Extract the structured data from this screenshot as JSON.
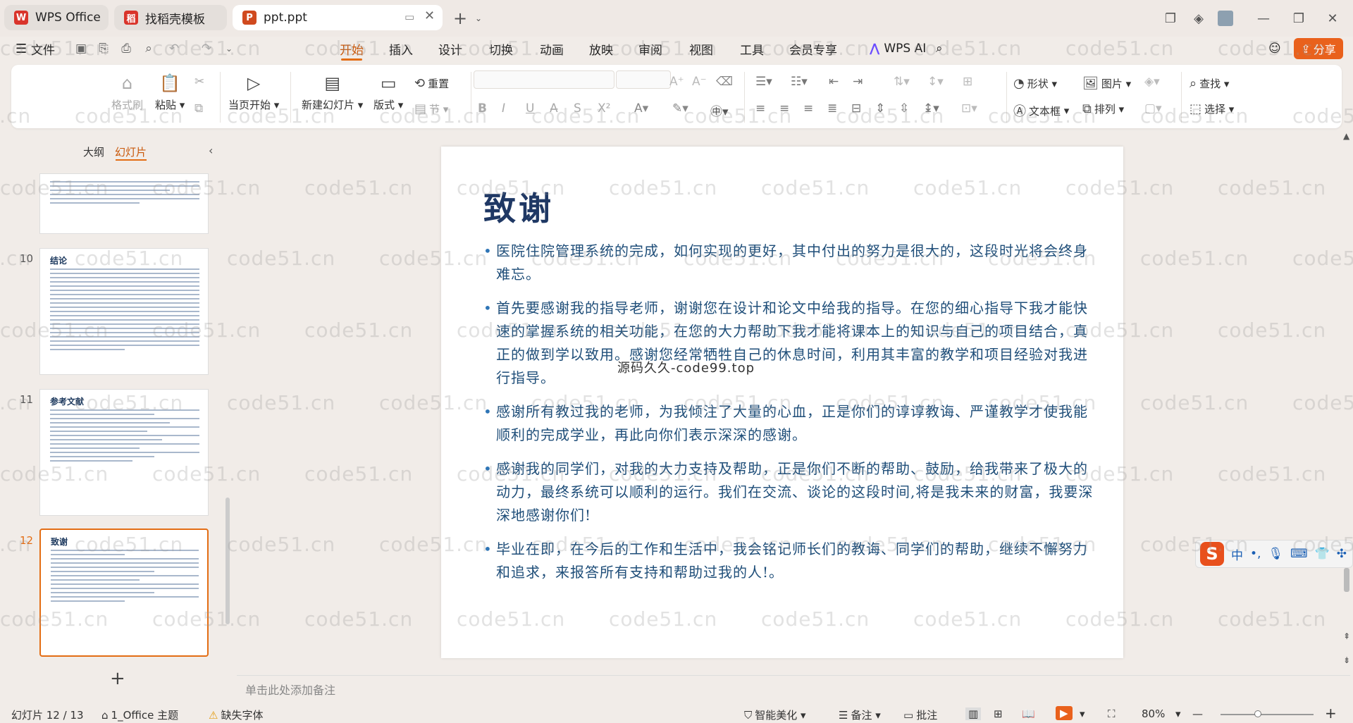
{
  "titlebar": {
    "tabs": [
      {
        "label": "WPS Office",
        "logo": "W",
        "color": "#d9342b"
      },
      {
        "label": "找稻壳模板",
        "logo": "稻",
        "color": "#d9342b"
      },
      {
        "label": "ppt.ppt",
        "logo": "P",
        "color": "#d04a1f"
      }
    ],
    "new_tab_icon": "+"
  },
  "menu": {
    "file": "文件",
    "items": [
      "开始",
      "插入",
      "设计",
      "切换",
      "动画",
      "放映",
      "审阅",
      "视图",
      "工具",
      "会员专享"
    ],
    "wps_ai": "WPS AI",
    "share": "分享",
    "active": "开始"
  },
  "ribbon": {
    "format_painter": "格式刷",
    "paste": "粘贴",
    "play_current": "当页开始",
    "new_slide": "新建幻灯片",
    "layout": "版式",
    "reset": "重置",
    "section": "节",
    "shape": "形状",
    "picture": "图片",
    "textbox": "文本框",
    "arrange": "排列",
    "find": "查找",
    "select": "选择"
  },
  "panel": {
    "outline_tab": "大纲",
    "slides_tab": "幻灯片",
    "add_icon": "+",
    "slides": [
      {
        "num": "10",
        "title": "结论"
      },
      {
        "num": "11",
        "title": "参考文献"
      },
      {
        "num": "12",
        "title": "致谢"
      }
    ]
  },
  "slide": {
    "title": "致谢",
    "bullets": [
      "医院住院管理系统的完成，如何实现的更好，其中付出的努力是很大的，这段时光将会终身难忘。",
      "首先要感谢我的指导老师，谢谢您在设计和论文中给我的指导。在您的细心指导下我才能快速的掌握系统的相关功能，在您的大力帮助下我才能将课本上的知识与自己的项目结合，真正的做到学以致用。感谢您经常牺牲自己的休息时间，利用其丰富的教学和项目经验对我进行指导。",
      "感谢所有教过我的老师，为我倾注了大量的心血，正是你们的谆谆教诲、严谨教学才使我能顺利的完成学业，再此向你们表示深深的感谢。",
      "感谢我的同学们，对我的大力支持及帮助，正是你们不断的帮助、鼓励，给我带来了极大的动力，最终系统可以顺利的运行。我们在交流、谈论的这段时间,将是我未来的财富，我要深深地感谢你们!",
      "毕业在即，在今后的工作和生活中，我会铭记师长们的教诲、同学们的帮助，继续不懈努力和追求，来报答所有支持和帮助过我的人!。"
    ],
    "overlay_watermark": "源码久久-code99.top"
  },
  "notes_placeholder": "单击此处添加备注",
  "status": {
    "slide_counter": "幻灯片 12 / 13",
    "theme": "1_Office 主题",
    "missing_font": "缺失字体",
    "smart_beautify": "智能美化",
    "notes": "备注",
    "comments": "批注",
    "zoom": "80%"
  },
  "ime": {
    "lang": "中"
  },
  "watermark_text": "code51.cn",
  "colors": {
    "accent": "#e36d14",
    "share": "#e9611c",
    "slide_title": "#1f3864",
    "slide_text": "#1f4e79"
  }
}
